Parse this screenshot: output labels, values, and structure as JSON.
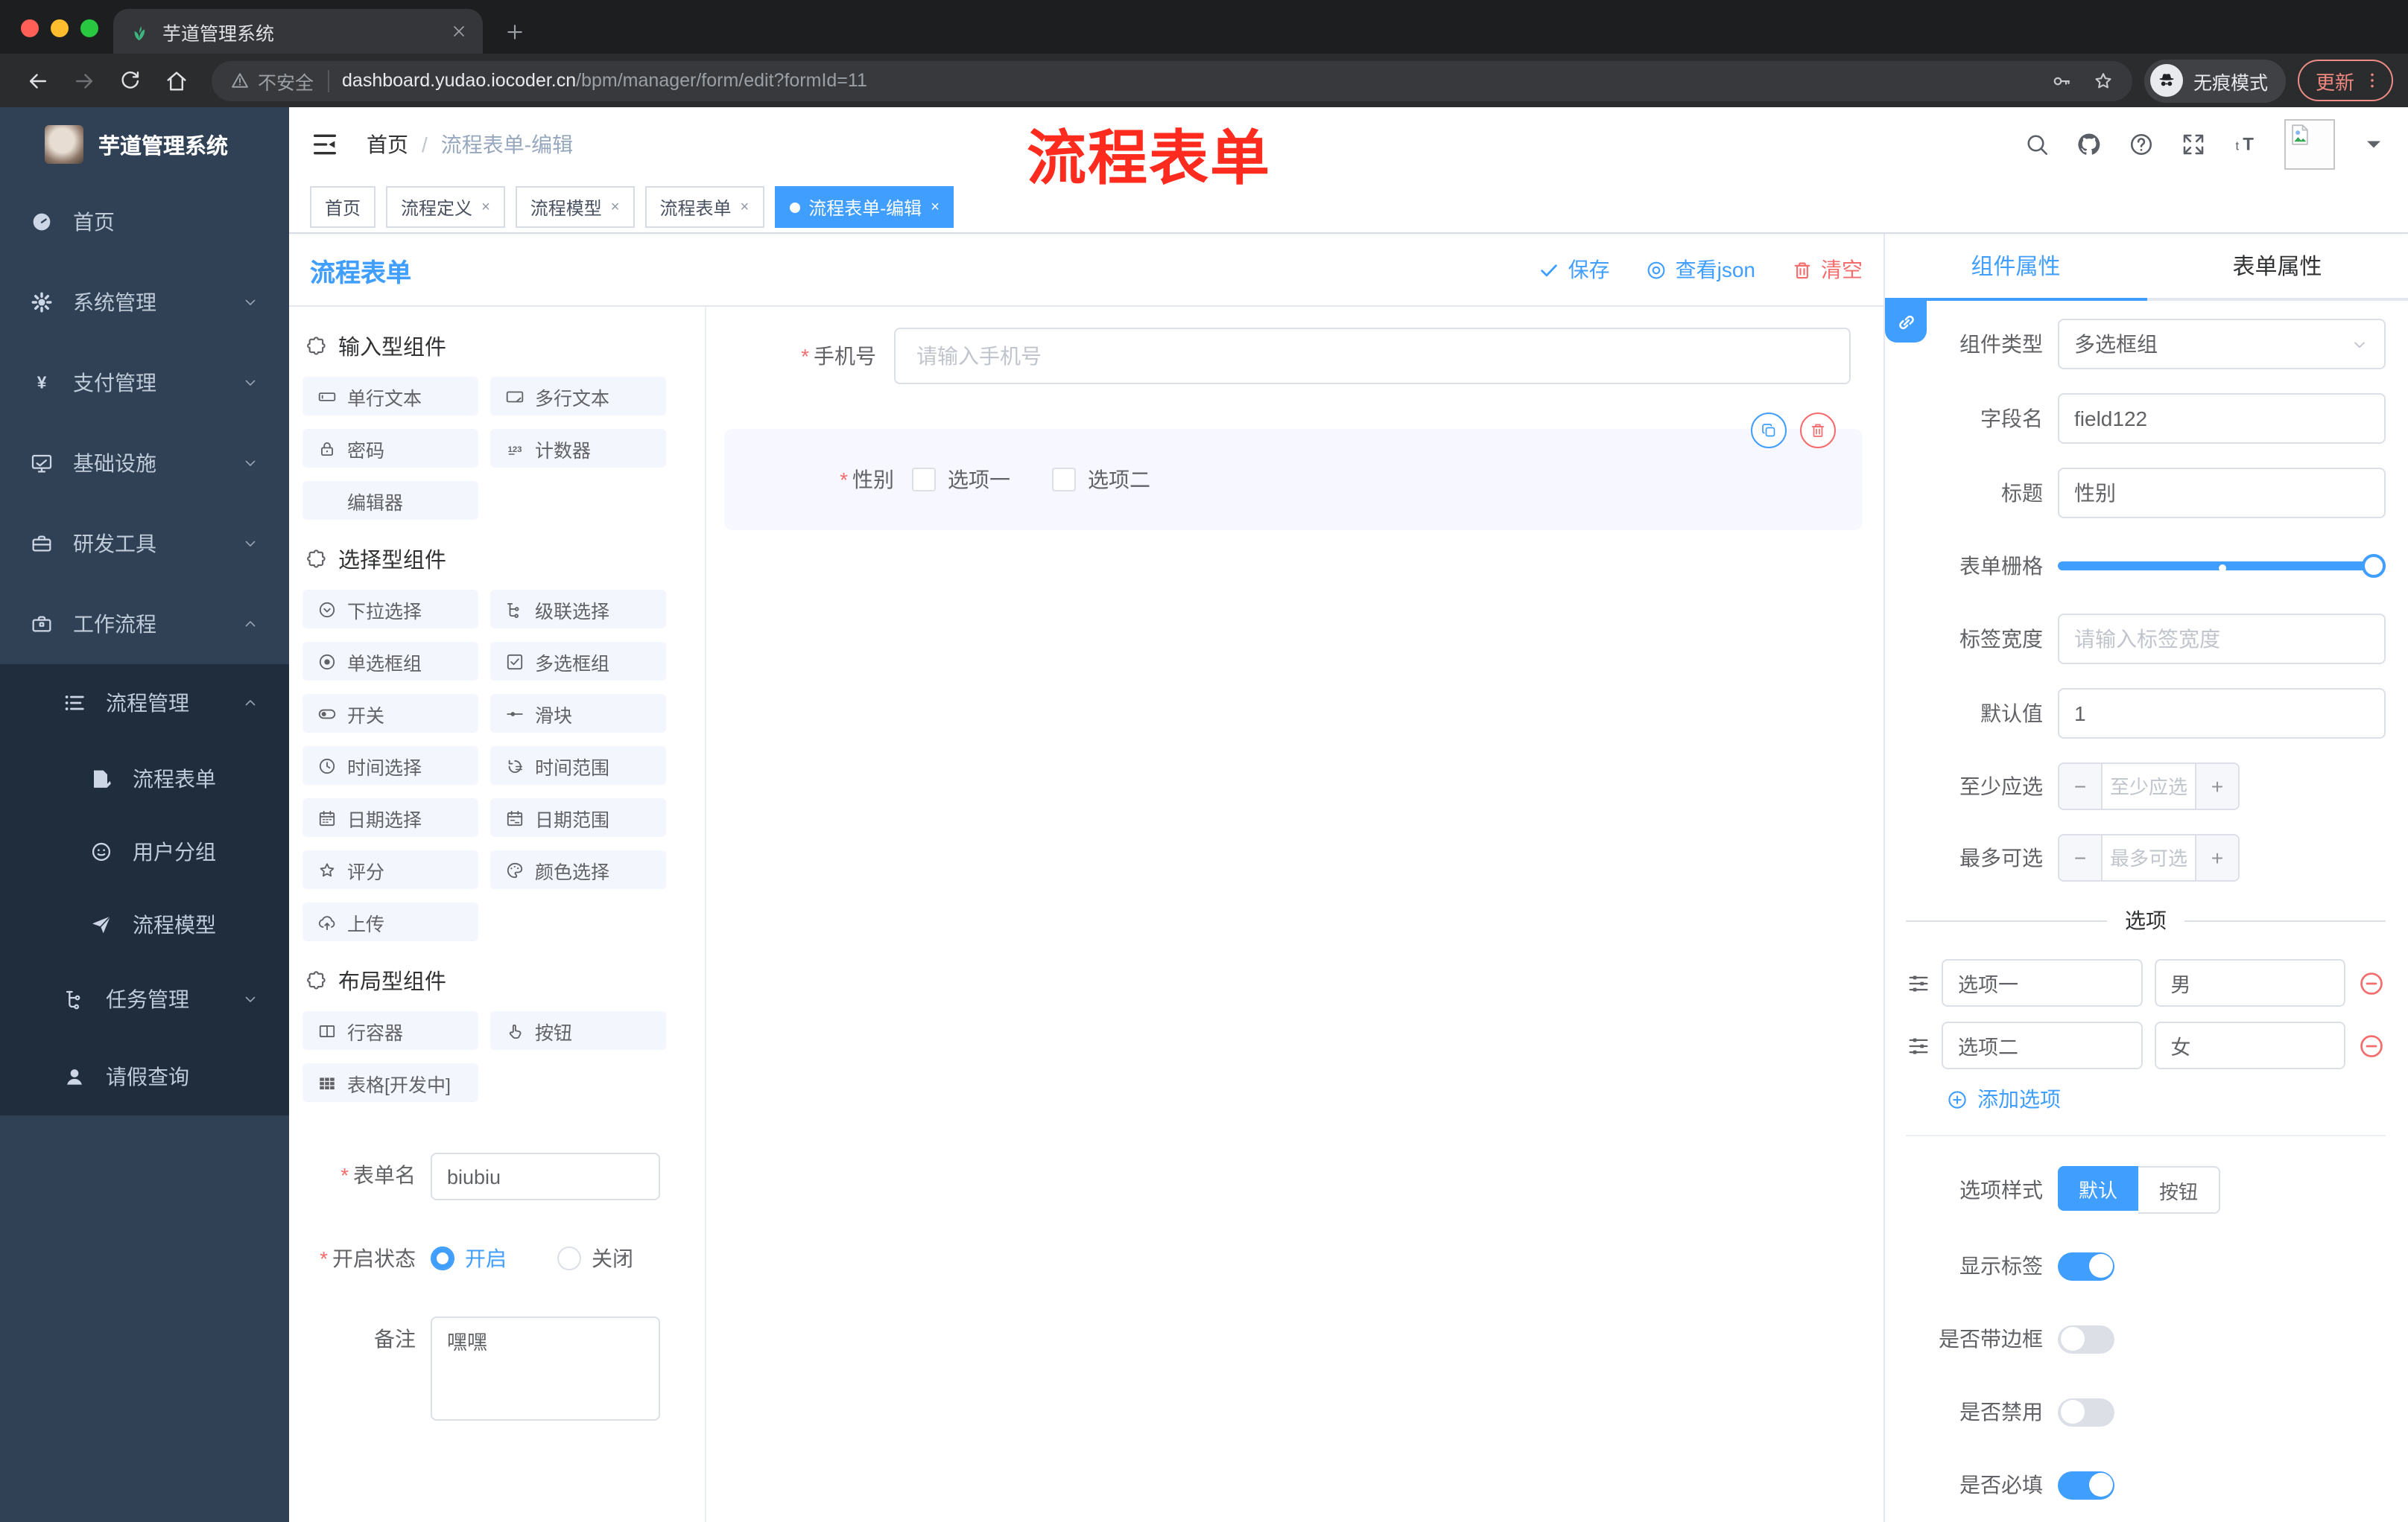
{
  "chrome": {
    "tab_title": "芋道管理系统",
    "security_label": "不安全",
    "url_domain": "dashboard.yudao.iocoder.cn",
    "url_path": "/bpm/manager/form/edit?formId=11",
    "incognito_label": "无痕模式",
    "update_label": "更新"
  },
  "sidebar": {
    "title": "芋道管理系统",
    "menu": [
      {
        "label": "首页",
        "icon": "dashboard",
        "indent": 0,
        "chevron": "",
        "dark": false
      },
      {
        "label": "系统管理",
        "icon": "gear",
        "indent": 0,
        "chevron": "down",
        "dark": false
      },
      {
        "label": "支付管理",
        "icon": "yen",
        "indent": 0,
        "chevron": "down",
        "dark": false
      },
      {
        "label": "基础设施",
        "icon": "monitor",
        "indent": 0,
        "chevron": "down",
        "dark": false
      },
      {
        "label": "研发工具",
        "icon": "toolbox",
        "indent": 0,
        "chevron": "down",
        "dark": false
      },
      {
        "label": "工作流程",
        "icon": "briefcase",
        "indent": 0,
        "chevron": "up",
        "dark": false
      },
      {
        "label": "流程管理",
        "icon": "listcfg",
        "indent": 1,
        "chevron": "up",
        "dark": true
      },
      {
        "label": "流程表单",
        "icon": "docedit",
        "indent": 2,
        "chevron": "",
        "dark": true
      },
      {
        "label": "用户分组",
        "icon": "face",
        "indent": 2,
        "chevron": "",
        "dark": true
      },
      {
        "label": "流程模型",
        "icon": "send",
        "indent": 2,
        "chevron": "",
        "dark": true
      },
      {
        "label": "任务管理",
        "icon": "tree",
        "indent": 1,
        "chevron": "down",
        "dark": true
      },
      {
        "label": "请假查询",
        "icon": "user",
        "indent": 1,
        "chevron": "",
        "dark": true
      }
    ]
  },
  "header": {
    "breadcrumb": [
      "首页",
      "流程表单-编辑"
    ],
    "annotation": "流程表单"
  },
  "tags": {
    "items": [
      {
        "label": "首页",
        "closable": false,
        "active": false
      },
      {
        "label": "流程定义",
        "closable": true,
        "active": false
      },
      {
        "label": "流程模型",
        "closable": true,
        "active": false
      },
      {
        "label": "流程表单",
        "closable": true,
        "active": false
      },
      {
        "label": "流程表单-编辑",
        "closable": true,
        "active": true
      }
    ]
  },
  "toolbar": {
    "title": "流程表单",
    "save": "保存",
    "view_json": "查看json",
    "clear": "清空"
  },
  "palette": {
    "groups": [
      {
        "title": "输入型组件",
        "items": [
          {
            "label": "单行文本",
            "icon": "inputbox"
          },
          {
            "label": "多行文本",
            "icon": "textareabox"
          },
          {
            "label": "密码",
            "icon": "lock"
          },
          {
            "label": "计数器",
            "icon": "counter"
          },
          {
            "label": "编辑器",
            "icon": ""
          }
        ]
      },
      {
        "title": "选择型组件",
        "items": [
          {
            "label": "下拉选择",
            "icon": "selecticon"
          },
          {
            "label": "级联选择",
            "icon": "cascade"
          },
          {
            "label": "单选框组",
            "icon": "radioicon"
          },
          {
            "label": "多选框组",
            "icon": "checkboxicon"
          },
          {
            "label": "开关",
            "icon": "switchicon"
          },
          {
            "label": "滑块",
            "icon": "slidericon"
          },
          {
            "label": "时间选择",
            "icon": "clock"
          },
          {
            "label": "时间范围",
            "icon": "timerange"
          },
          {
            "label": "日期选择",
            "icon": "calendar"
          },
          {
            "label": "日期范围",
            "icon": "daterange"
          },
          {
            "label": "评分",
            "icon": "star"
          },
          {
            "label": "颜色选择",
            "icon": "paletteicon"
          },
          {
            "label": "上传",
            "icon": "upload"
          }
        ]
      },
      {
        "title": "布局型组件",
        "items": [
          {
            "label": "行容器",
            "icon": "rowicon"
          },
          {
            "label": "按钮",
            "icon": "hand"
          },
          {
            "label": "表格[开发中]",
            "icon": "tableicon"
          }
        ]
      }
    ]
  },
  "form_meta": {
    "name_label": "表单名",
    "name_value": "biubiu",
    "status_label": "开启状态",
    "status_on": "开启",
    "status_off": "关闭",
    "remark_label": "备注",
    "remark_value": "嘿嘿"
  },
  "canvas": {
    "phone_label": "手机号",
    "phone_placeholder": "请输入手机号",
    "gender_label": "性别",
    "gender_options": [
      "选项一",
      "选项二"
    ]
  },
  "panel": {
    "tabs": [
      "组件属性",
      "表单属性"
    ],
    "component_type_label": "组件类型",
    "component_type_value": "多选框组",
    "field_name_label": "字段名",
    "field_name_value": "field122",
    "title_label": "标题",
    "title_value": "性别",
    "grid_label": "表单栅格",
    "label_width_label": "标签宽度",
    "label_width_placeholder": "请输入标签宽度",
    "default_label": "默认值",
    "default_value": "1",
    "min_label": "至少应选",
    "min_placeholder": "至少应选",
    "max_label": "最多可选",
    "max_placeholder": "最多可选",
    "options_title": "选项",
    "options": {
      "rows": [
        {
          "name": "选项一",
          "value": "男"
        },
        {
          "name": "选项二",
          "value": "女"
        }
      ],
      "add_label": "添加选项"
    },
    "style_label": "选项样式",
    "style_default": "默认",
    "style_button": "按钮",
    "switches": [
      {
        "label": "显示标签",
        "on": true
      },
      {
        "label": "是否带边框",
        "on": false
      },
      {
        "label": "是否禁用",
        "on": false
      },
      {
        "label": "是否必填",
        "on": true
      }
    ]
  },
  "colors": {
    "accent": "#409eff",
    "danger": "#f56c6c",
    "annotation": "#fe2b1e",
    "sidebar": "#304156",
    "submenu": "#1f2d3d"
  }
}
